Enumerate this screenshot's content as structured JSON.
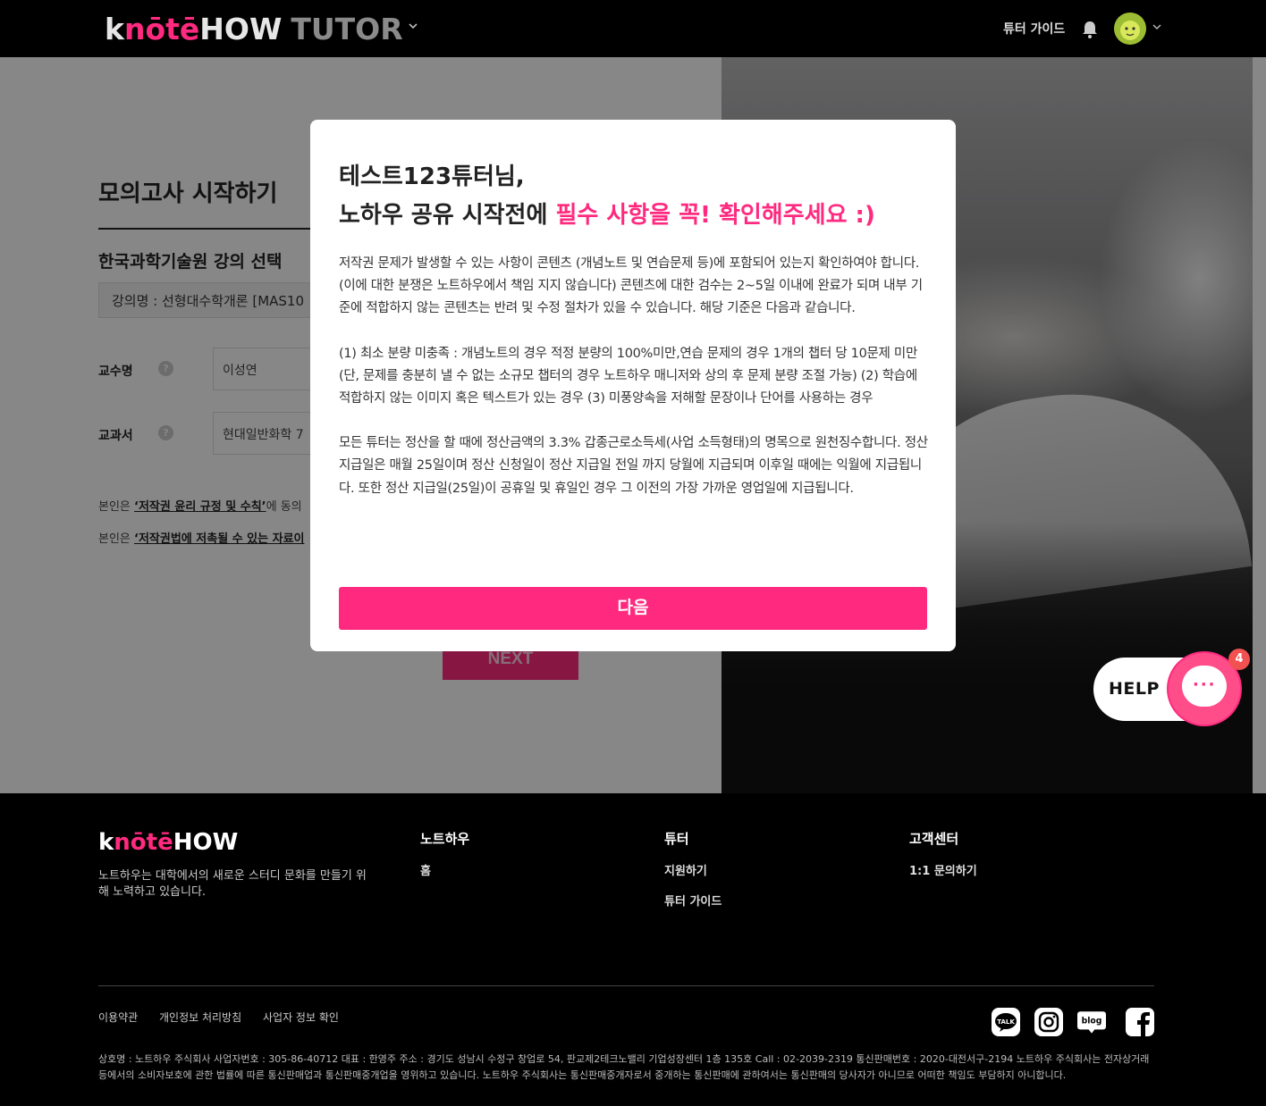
{
  "header": {
    "logo_k": "k",
    "logo_note": "nōtē",
    "logo_how": "HOW",
    "logo_tutor": "TUTOR",
    "guide_link": "튜터 가이드"
  },
  "page": {
    "title": "모의고사 시작하기",
    "subtitle": "한국과학기술원 강의 선택",
    "course_value": "강의명 : 선형대수학개론 [MAS10",
    "professor_label": "교수명",
    "professor_value": "이성연",
    "textbook_label": "교과서",
    "textbook_value": "현대일반화학 7",
    "agree1_prefix": "본인은 ",
    "agree1_link": "‘저작권 윤리 규정 및 수칙’",
    "agree1_suffix": "에 동의",
    "agree2_prefix": "본인은 ",
    "agree2_link": "‘저작권법에 저촉될 수 있는 자료이",
    "next_label": "NEXT",
    "help_glyph": "?"
  },
  "modal": {
    "heading_line1": "테스트123튜터님,",
    "heading_line2_plain": "노하우 공유 시작전에 ",
    "heading_line2_highlight": "필수 사항을 꼭! 확인해주세요 :)",
    "para1": "저작권 문제가 발생할 수 있는 사항이 콘텐츠 (개념노트 및 연습문제 등)에 포함되어 있는지 확인하여야 합니다. (이에 대한 분쟁은 노트하우에서 책임 지지 않습니다) 콘텐츠에 대한 검수는 2~5일 이내에 완료가 되며 내부 기준에 적합하지 않는 콘텐츠는 반려 및 수정 절차가 있을 수 있습니다. 해당 기준은 다음과 같습니다.",
    "para2": "(1) 최소 분량 미충족 : 개념노트의 경우 적정 분량의 100%미만,연습 문제의 경우 1개의 챕터 당 10문제 미만 (단, 문제를 충분히 낼 수 없는 소규모 챕터의 경우 노트하우 매니저와 상의 후 문제 분량 조절 가능) (2) 학습에 적합하지 않는 이미지 혹은 텍스트가 있는 경우 (3) 미풍양속을 저해할 문장이나 단어를 사용하는 경우",
    "para3": "모든 튜터는 정산을 할 때에 정산금액의 3.3% 갑종근로소득세(사업 소득형태)의 명목으로 원천징수합니다. 정산 지급일은 매월 25일이며 정산 신청일이 정산 지급일 전일 까지 당월에 지급되며 이후일 때에는 익월에 지급됩니다. 또한 정산 지급일(25일)이 공휴일 및 휴일인 경우 그 이전의 가장 가까운 영업일에 지급됩니다.",
    "button_label": "다음"
  },
  "help": {
    "label": "HELP",
    "dots": "···",
    "badge_count": "4"
  },
  "footer": {
    "logo_k": "k",
    "logo_note": "nōtē",
    "logo_how": "HOW",
    "description": "노트하우는 대학에서의 새로운 스터디 문화를 만들기 위해 노력하고 있습니다.",
    "columns": [
      {
        "heading": "노트하우",
        "links": [
          "홈"
        ]
      },
      {
        "heading": "튜터",
        "links": [
          "지원하기",
          "튜터 가이드"
        ]
      },
      {
        "heading": "고객센터",
        "links": [
          "1:1 문의하기"
        ]
      }
    ],
    "bottom_links": [
      "이용약관",
      "개인정보 처리방침",
      "사업자 정보 확인"
    ],
    "legal": "상호명 : 노트하우 주식회사 사업자번호 : 305-86-40712 대표 : 한영주 주소 : 경기도 성남시 수정구 창업로 54, 판교제2테크노밸리 기업성장센터 1층 135호 Call : 02-2039-2319 통신판매번호 : 2020-대전서구-2194 노트하우 주식회사는 전자상거래 등에서의 소비자보호에 관한 법률에 따른 통신판매업과 통신판매중개업을 영위하고 있습니다. 노트하우 주식회사는 통신판매중개자로서 중개하는 통신판매에 관하여서는 통신판매의 당사자가 아니므로 어떠한 책임도 부담하지 아니합니다.",
    "social": [
      "kakaotalk-icon",
      "instagram-icon",
      "blog-icon",
      "facebook-icon"
    ],
    "social_text": {
      "talk": "TALK",
      "blog": "blog"
    }
  },
  "colors": {
    "accent": "#ff2a7f",
    "badge": "#f15151"
  }
}
